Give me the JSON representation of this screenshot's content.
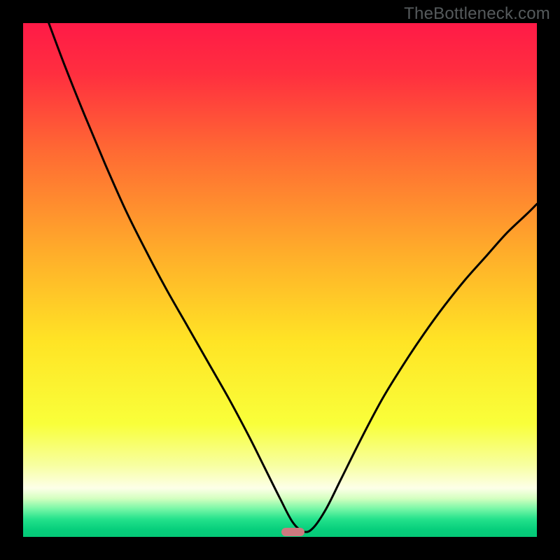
{
  "watermark": "TheBottleneck.com",
  "marker": {
    "x_frac": 0.525,
    "width_frac": 0.045,
    "color": "#cc7a7f"
  },
  "gradient_stops": [
    {
      "pos": 0.0,
      "color": "#ff1a47"
    },
    {
      "pos": 0.1,
      "color": "#ff2f3f"
    },
    {
      "pos": 0.25,
      "color": "#ff6a33"
    },
    {
      "pos": 0.45,
      "color": "#ffae2a"
    },
    {
      "pos": 0.62,
      "color": "#ffe425"
    },
    {
      "pos": 0.78,
      "color": "#f9ff3a"
    },
    {
      "pos": 0.86,
      "color": "#f7ffa0"
    },
    {
      "pos": 0.905,
      "color": "#fdffe8"
    },
    {
      "pos": 0.925,
      "color": "#d4ffc0"
    },
    {
      "pos": 0.945,
      "color": "#78f7a7"
    },
    {
      "pos": 0.965,
      "color": "#25e28c"
    },
    {
      "pos": 0.985,
      "color": "#07cf7c"
    },
    {
      "pos": 1.0,
      "color": "#04c877"
    }
  ],
  "chart_data": {
    "type": "line",
    "title": "",
    "xlabel": "",
    "ylabel": "",
    "xlim": [
      0,
      1
    ],
    "ylim": [
      0,
      1
    ],
    "grid": false,
    "legend": false,
    "series": [
      {
        "name": "bottleneck-curve",
        "x": [
          0.05,
          0.08,
          0.12,
          0.16,
          0.2,
          0.24,
          0.28,
          0.32,
          0.36,
          0.4,
          0.44,
          0.47,
          0.5,
          0.525,
          0.547,
          0.565,
          0.59,
          0.62,
          0.66,
          0.7,
          0.74,
          0.78,
          0.82,
          0.86,
          0.9,
          0.94,
          0.98,
          1.0
        ],
        "y": [
          1.0,
          0.92,
          0.82,
          0.725,
          0.635,
          0.555,
          0.48,
          0.41,
          0.34,
          0.27,
          0.195,
          0.135,
          0.075,
          0.028,
          0.01,
          0.018,
          0.055,
          0.115,
          0.195,
          0.27,
          0.335,
          0.395,
          0.45,
          0.5,
          0.545,
          0.59,
          0.628,
          0.648
        ]
      }
    ],
    "annotations": [
      {
        "type": "marker",
        "x": 0.525,
        "width": 0.045,
        "label": "optimal-point"
      }
    ]
  }
}
